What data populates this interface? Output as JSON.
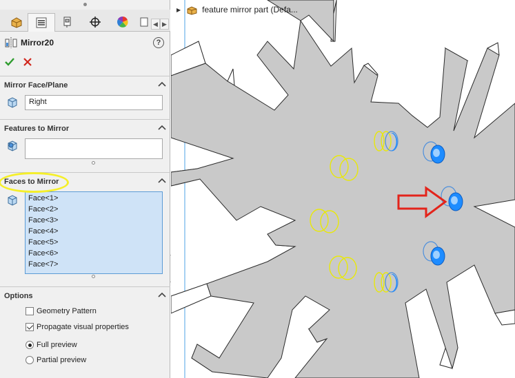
{
  "property_manager": {
    "title": "Mirror20",
    "help_label": "?",
    "tabs": [
      "feature-manager-tab",
      "property-manager-tab",
      "configuration-manager-tab",
      "dimxpert-manager-tab",
      "display-manager-tab",
      "more-tab"
    ],
    "active_tab": 1
  },
  "groups": {
    "mirror_face": {
      "title": "Mirror Face/Plane",
      "value": "Right"
    },
    "features": {
      "title": "Features to Mirror",
      "value": ""
    },
    "faces": {
      "title": "Faces to Mirror",
      "items": [
        "Face<1>",
        "Face<2>",
        "Face<3>",
        "Face<4>",
        "Face<5>",
        "Face<6>",
        "Face<7>"
      ]
    },
    "options": {
      "title": "Options",
      "geometry_pattern": {
        "label": "Geometry Pattern",
        "checked": false
      },
      "propagate": {
        "label": "Propagate visual properties",
        "checked": true
      },
      "full_preview": {
        "label": "Full preview",
        "selected": true
      },
      "partial_preview": {
        "label": "Partial preview",
        "selected": false
      }
    }
  },
  "viewport": {
    "tree_label": "feature mirror part  (Defa..."
  },
  "colors": {
    "accent": "#5b9bd5",
    "highlight": "#f5ef2a",
    "arrow": "#e3241b",
    "preview": "#e8e80a",
    "selected_face": "#1e8cff"
  }
}
